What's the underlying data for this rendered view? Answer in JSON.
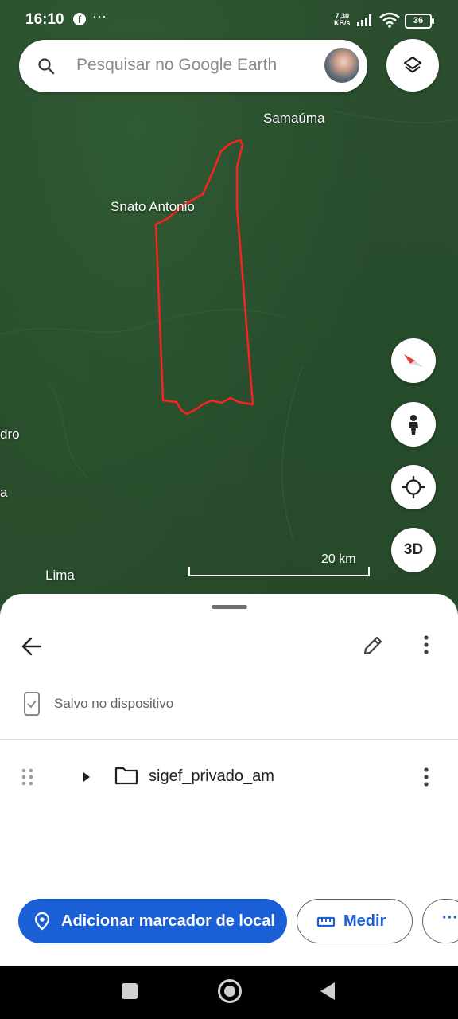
{
  "status_bar": {
    "time": "16:10",
    "speed_value": "7,30",
    "speed_unit": "KB/s",
    "battery": "36"
  },
  "search": {
    "placeholder": "Pesquisar no Google Earth"
  },
  "map": {
    "labels": {
      "samauma": "Samaúma",
      "santo_antonio": "Snato Antonio",
      "partial_left_1": "dro",
      "partial_left_2": "a",
      "lima": "Lima"
    },
    "scale_label": "20 km",
    "polygon_color": "#ff2020",
    "controls": {
      "view_3d": "3D"
    }
  },
  "sheet": {
    "saved_text": "Salvo no dispositivo",
    "items": [
      {
        "label": "sigef_privado_am"
      }
    ],
    "actions": {
      "add_placemark": "Adicionar marcador de local",
      "measure": "Medir",
      "more": "···"
    }
  },
  "colors": {
    "primary": "#1a5fd6"
  }
}
